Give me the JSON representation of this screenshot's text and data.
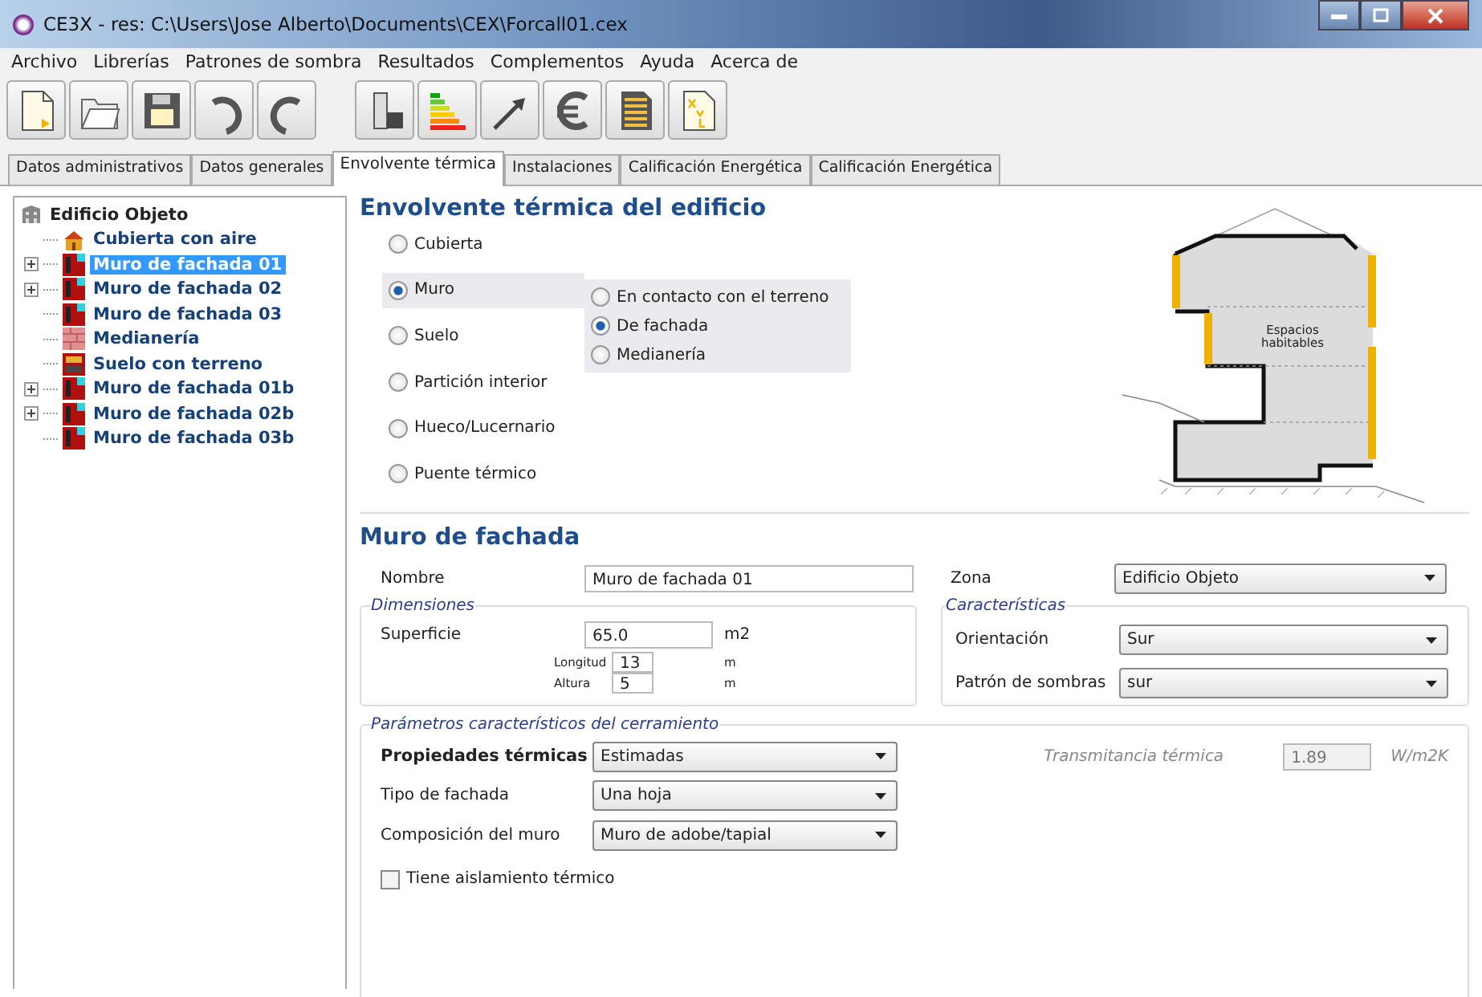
{
  "window": {
    "title": "CE3X - res: C:\\Users\\Jose Alberto\\Documents\\CEX\\Forcall01.cex"
  },
  "menu": [
    "Archivo",
    "Librerías",
    "Patrones de sombra",
    "Resultados",
    "Complementos",
    "Ayuda",
    "Acerca de"
  ],
  "tabs": [
    {
      "label": "Datos administrativos",
      "selected": false
    },
    {
      "label": "Datos generales",
      "selected": false
    },
    {
      "label": "Envolvente térmica",
      "selected": true
    },
    {
      "label": "Instalaciones",
      "selected": false
    },
    {
      "label": "Calificación Energética",
      "selected": false
    },
    {
      "label": "Calificación Energética",
      "selected": false
    }
  ],
  "tree": {
    "label": "Edificio Objeto",
    "children": [
      {
        "label": "Cubierta con aire",
        "kind": "roof",
        "expandable": false,
        "selected": false
      },
      {
        "label": "Muro de fachada 01",
        "kind": "wall",
        "expandable": true,
        "selected": true
      },
      {
        "label": "Muro de fachada 02",
        "kind": "wall",
        "expandable": true,
        "selected": false
      },
      {
        "label": "Muro de fachada 03",
        "kind": "wall",
        "expandable": false,
        "selected": false
      },
      {
        "label": "Medianería",
        "kind": "party-wall",
        "expandable": false,
        "selected": false
      },
      {
        "label": "Suelo con terreno",
        "kind": "floor",
        "expandable": false,
        "selected": false
      },
      {
        "label": "Muro de fachada 01b",
        "kind": "wall",
        "expandable": true,
        "selected": false
      },
      {
        "label": "Muro de fachada 02b",
        "kind": "wall",
        "expandable": true,
        "selected": false
      },
      {
        "label": "Muro de fachada 03b",
        "kind": "wall",
        "expandable": false,
        "selected": false
      }
    ]
  },
  "envelope": {
    "title": "Envolvente térmica del edificio",
    "types": [
      {
        "label": "Cubierta",
        "selected": false
      },
      {
        "label": "Muro",
        "selected": true
      },
      {
        "label": "Suelo",
        "selected": false
      },
      {
        "label": "Partición interior",
        "selected": false
      },
      {
        "label": "Hueco/Lucernario",
        "selected": false
      },
      {
        "label": "Puente térmico",
        "selected": false
      }
    ],
    "subtypes": [
      {
        "label": "En contacto con el terreno",
        "selected": false
      },
      {
        "label": "De fachada",
        "selected": true
      },
      {
        "label": "Medianería",
        "selected": false
      }
    ],
    "diagram_label": "Espacios habitables"
  },
  "element": {
    "title": "Muro de fachada",
    "name": {
      "label": "Nombre",
      "value": "Muro de fachada 01"
    },
    "zone": {
      "label": "Zona",
      "value": "Edificio Objeto"
    },
    "dimensions": {
      "legend": "Dimensiones",
      "area": {
        "label": "Superficie",
        "value": "65.0",
        "unit": "m2"
      },
      "length": {
        "label": "Longitud",
        "value": "13",
        "unit": "m"
      },
      "height": {
        "label": "Altura",
        "value": "5",
        "unit": "m"
      }
    },
    "characteristics": {
      "legend": "Características",
      "orientation": {
        "label": "Orientación",
        "value": "Sur"
      },
      "shading": {
        "label": "Patrón de sombras",
        "value": "sur"
      }
    },
    "parameters": {
      "legend": "Parámetros característicos del cerramiento",
      "dropdowns": [
        {
          "label": "Propiedades térmicas",
          "value": "Estimadas",
          "bold": true
        },
        {
          "label": "Tipo de fachada",
          "value": "Una hoja",
          "bold": false
        },
        {
          "label": "Composición del muro",
          "value": "Muro de adobe/tapial",
          "bold": false
        }
      ],
      "insulation": {
        "label": "Tiene aislamiento térmico",
        "checked": false
      },
      "transmittance": {
        "label": "Transmitancia térmica",
        "value": "1.89",
        "unit": "W/m2K",
        "disabled": true
      }
    }
  }
}
